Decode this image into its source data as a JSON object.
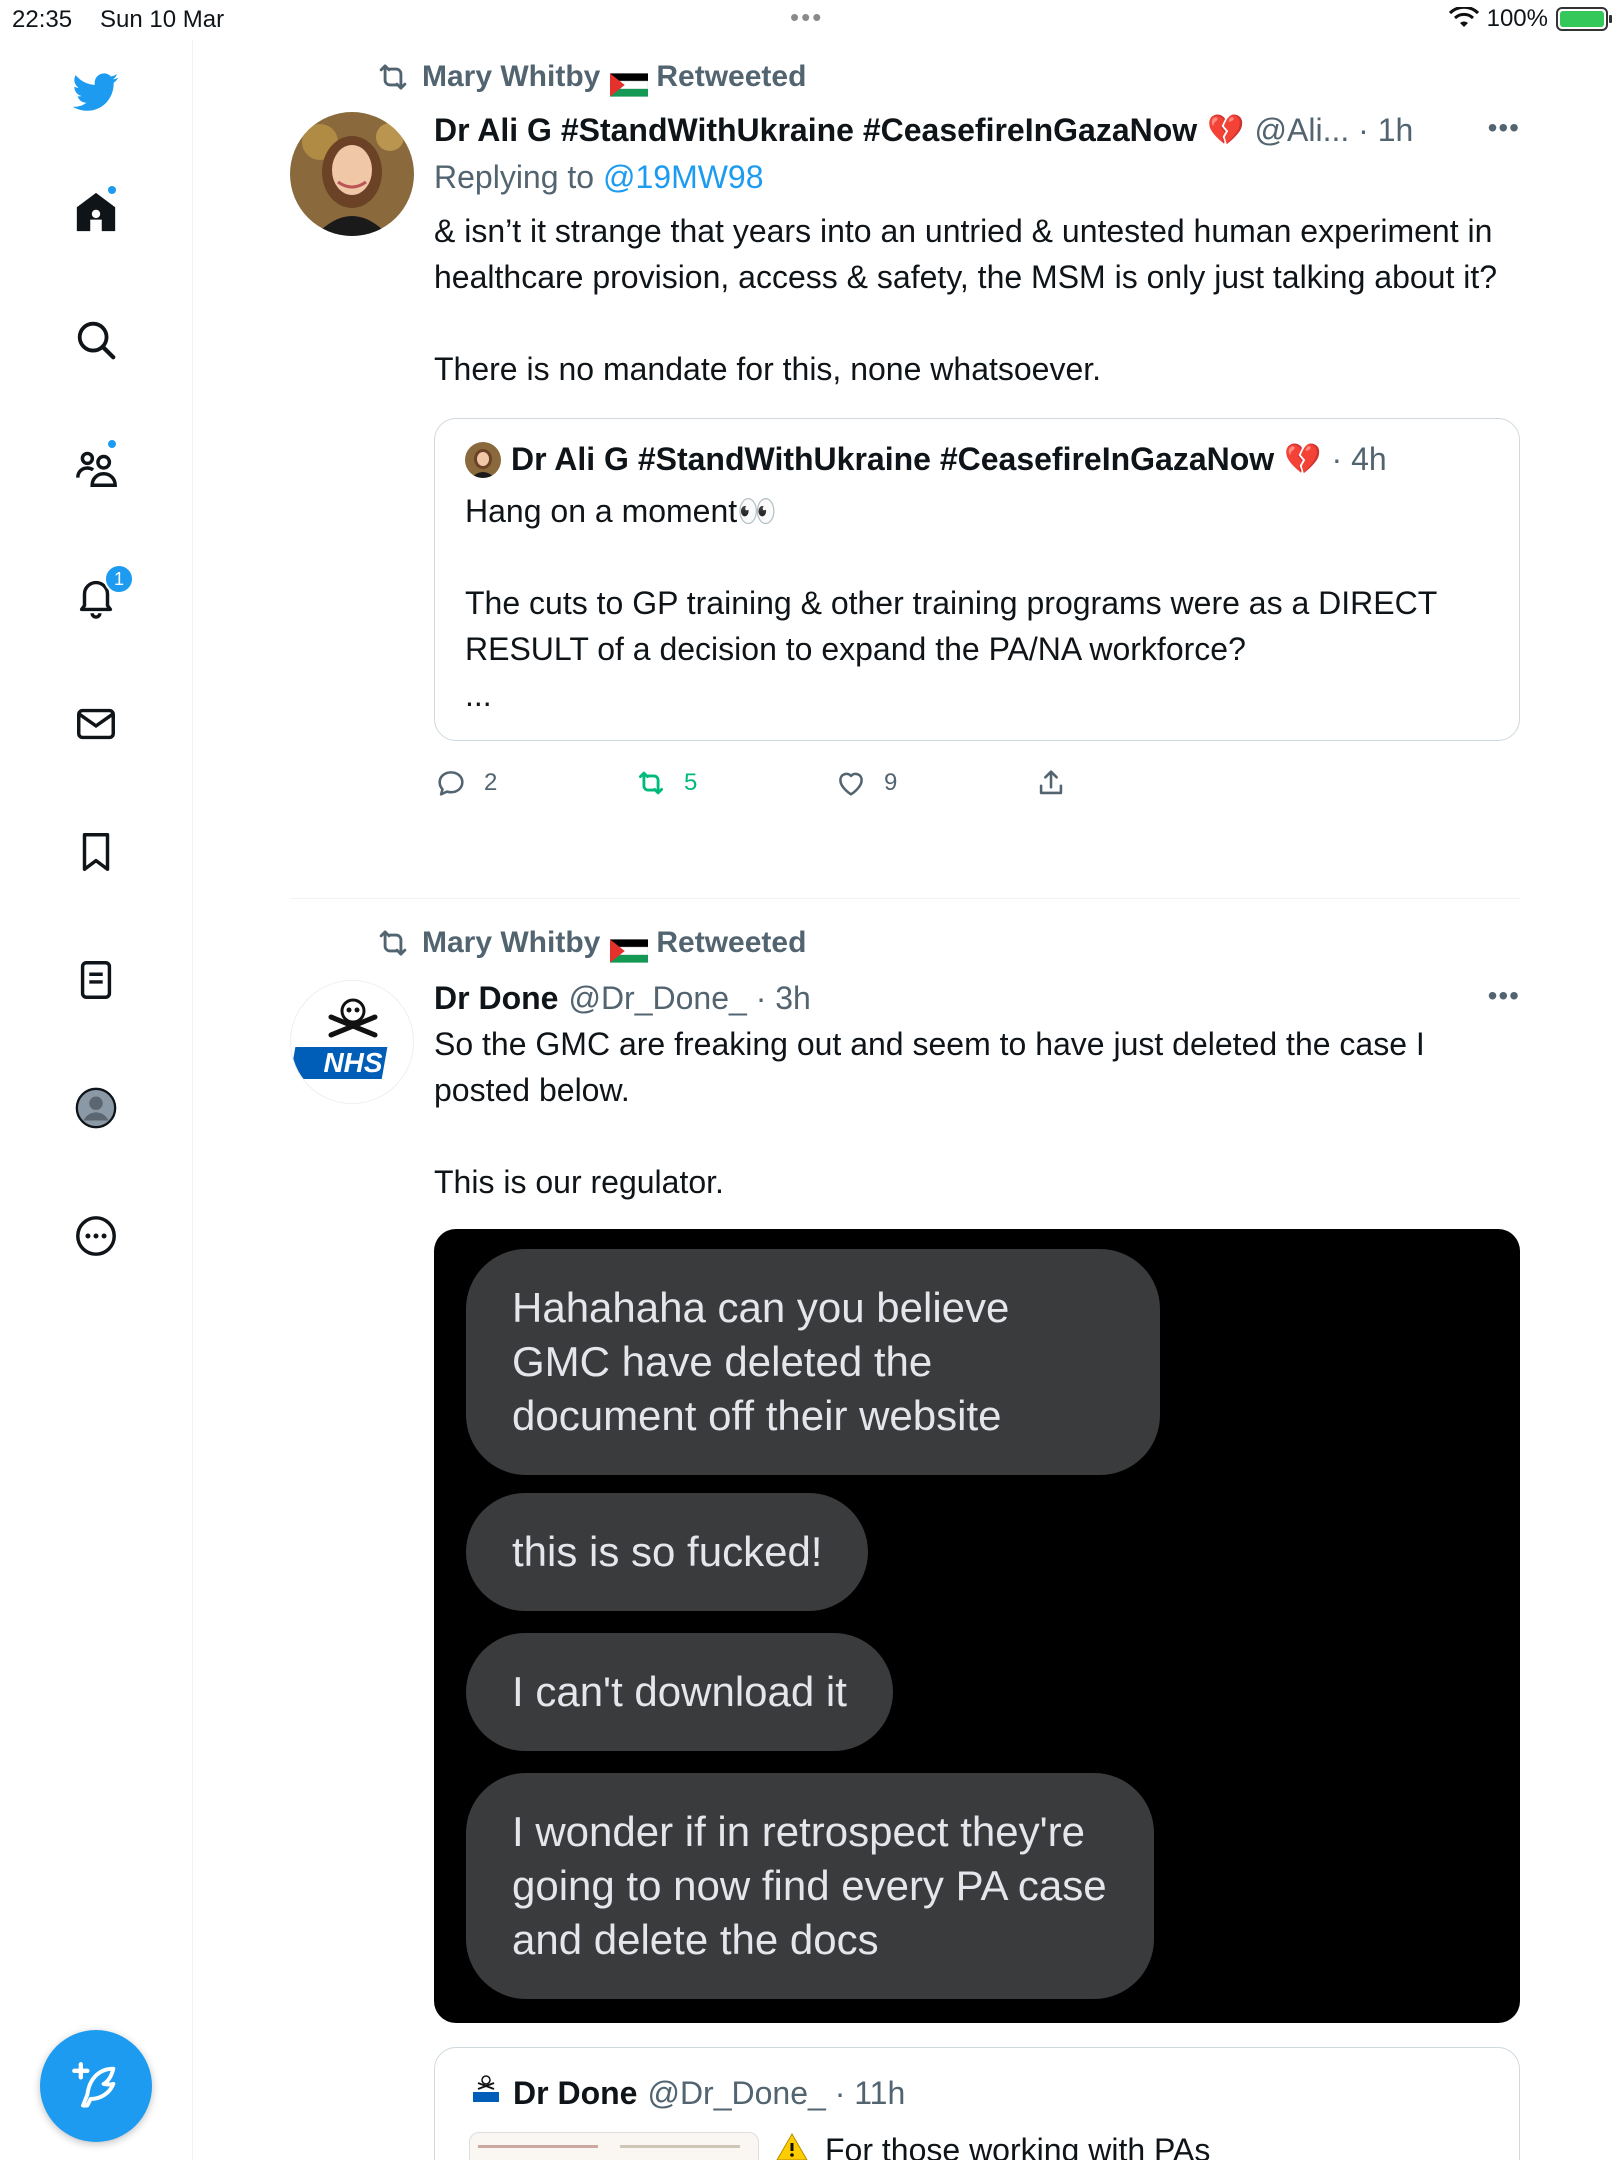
{
  "status_bar": {
    "time": "22:35",
    "date": "Sun 10 Mar",
    "battery": "100%"
  },
  "sidebar": {
    "notifications_badge": "1",
    "items": [
      "twitter-logo",
      "home",
      "explore",
      "communities",
      "notifications",
      "messages",
      "bookmarks",
      "lists",
      "profile",
      "more"
    ]
  },
  "colors": {
    "accent": "#1d9bf0",
    "retweet_green": "#00ba7c",
    "muted": "#536471"
  },
  "tweets": [
    {
      "retweeted_by": "Mary Whitby",
      "retweeted_label": "Retweeted",
      "author_name": "Dr Ali G #StandWithUkraine #CeasefireInGazaNow",
      "handle_time": "@Ali... · 1h",
      "reply_prefix": "Replying to",
      "reply_handle": "@19MW98",
      "text": "& isn’t it strange that years into an untried & untested human experiment in healthcare provision, access & safety, the MSM is only just talking about it?\n\nThere is no mandate for this, none whatsoever.",
      "quote": {
        "author_name": "Dr Ali G #StandWithUkraine #CeasefireInGazaNow",
        "time": "· 4h",
        "text": "Hang on a moment👀\n\nThe cuts to GP training & other training programs were as a DIRECT RESULT of a decision to expand the PA/NA workforce?\n..."
      },
      "actions": {
        "replies": "2",
        "retweets": "5",
        "likes": "9"
      }
    },
    {
      "retweeted_by": "Mary Whitby",
      "retweeted_label": "Retweeted",
      "author_name": "Dr Done",
      "handle_time": "@Dr_Done_ · 3h",
      "avatar_text": "NHS",
      "text": "So the GMC are freaking out and seem to have just deleted the case I posted below.\n\nThis is our regulator.",
      "media_messages": [
        "Hahahaha can you believe GMC have deleted the document off their website",
        "this is so fucked!",
        "I can't download it",
        "I wonder if in retrospect they're going to now find every PA case and delete the docs"
      ],
      "quote": {
        "author_name": "Dr Done",
        "handle_time": "@Dr_Done_ · 11h",
        "text": "For those working with PAs"
      }
    }
  ]
}
